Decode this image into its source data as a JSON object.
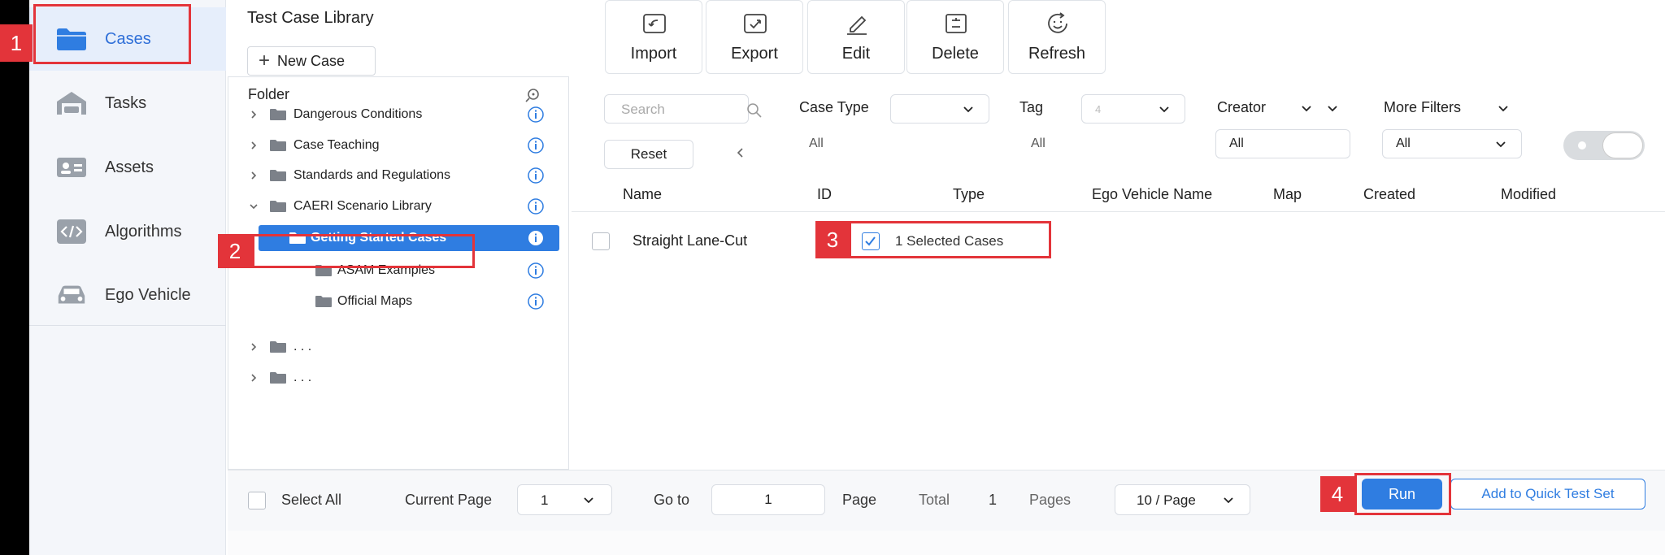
{
  "sidebar": {
    "items": [
      {
        "label": "Cases",
        "icon": "folder-icon"
      },
      {
        "label": "Tasks",
        "icon": "garage-icon"
      },
      {
        "label": "Assets",
        "icon": "id-card-icon"
      },
      {
        "label": "Algorithms",
        "icon": "code-icon"
      },
      {
        "label": "Ego Vehicle",
        "icon": "car-icon"
      }
    ]
  },
  "markers": [
    "1",
    "2",
    "3",
    "4"
  ],
  "library": {
    "title": "Test Case Library",
    "new_case_label": "New Case",
    "folder_header": "Folder",
    "tree": [
      {
        "label": "Dangerous Conditions"
      },
      {
        "label": "Case Teaching"
      },
      {
        "label": "Standards and Regulations"
      },
      {
        "label": "CAERI Scenario Library"
      },
      {
        "label": "Getting Started Cases"
      },
      {
        "label": "ASAM Examples"
      },
      {
        "label": "Official Maps"
      },
      {
        "label": ". . ."
      },
      {
        "label": ". . ."
      }
    ]
  },
  "toolbar": {
    "buttons": [
      {
        "label": "Import",
        "icon": "import-icon"
      },
      {
        "label": "Export",
        "icon": "export-icon"
      },
      {
        "label": "Edit",
        "icon": "pencil-icon"
      },
      {
        "label": "Delete",
        "icon": "delete-icon"
      },
      {
        "label": "Refresh",
        "icon": "refresh-icon"
      }
    ]
  },
  "filters": {
    "search_placeholder": "Search",
    "case_type_label": "Case Type",
    "case_type_value": "",
    "case_type_sub": "All",
    "tag_label": "Tag",
    "tag_value": "4",
    "tag_sub": "All",
    "creator_label": "Creator",
    "creator_value": "All",
    "more_filters_label": "More Filters",
    "more_filters_value": "All",
    "reset_label": "Reset"
  },
  "table": {
    "columns": [
      "Name",
      "ID",
      "Type",
      "Ego Vehicle Name",
      "Map",
      "Created",
      "Modified"
    ],
    "rows": [
      {
        "name": "Straight Lane-Cut"
      }
    ],
    "selected_text": "1 Selected Cases"
  },
  "footer": {
    "select_all": "Select All",
    "current_page_label": "Current Page",
    "current_page_value": "1",
    "go_to_label": "Go to",
    "go_to_value": "1",
    "page_label": "Page",
    "total_label": "Total",
    "total_value": "1",
    "pages_label": "Pages",
    "page_size": "10 / Page",
    "run_label": "Run",
    "quick_test_label": "Add to Quick Test Set"
  },
  "colors": {
    "accent": "#2f7de1",
    "marker": "#e3343a"
  }
}
